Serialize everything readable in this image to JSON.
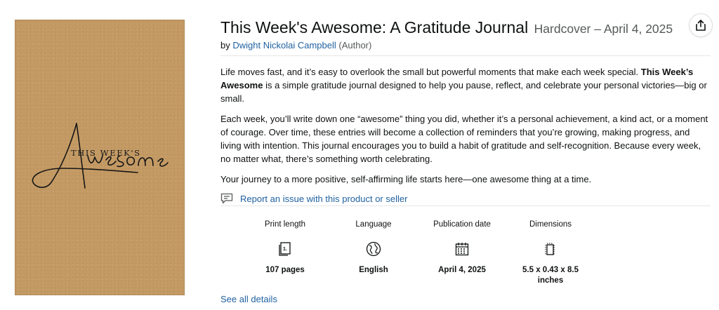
{
  "cover": {
    "top_text": "THIS WEEK'S",
    "script_text": "Awesome"
  },
  "product": {
    "title": "This Week's Awesome: A Gratitude Journal",
    "format_date": "Hardcover – April 4, 2025",
    "by_prefix": "by",
    "author": "Dwight Nickolai Campbell",
    "author_role": "(Author)"
  },
  "description": {
    "p1_a": "Life moves fast, and it’s easy to overlook the small but powerful moments that make each week special. ",
    "p1_bold": "This Week’s Awesome",
    "p1_b": " is a simple gratitude journal designed to help you pause, reflect, and celebrate your personal victories—big or small.",
    "p2": "Each week, you’ll write down one “awesome” thing you did, whether it’s a personal achievement, a kind act, or a moment of courage. Over time, these entries will become a collection of reminders that you’re growing, making progress, and living with intention. This journal encourages you to build a habit of gratitude and self-recognition. Because every week, no matter what, there’s something worth celebrating.",
    "p3": "Your journey to a more positive, self-affirming life starts here—one awesome thing at a time."
  },
  "report_link": "Report an issue with this product or seller",
  "specs": [
    {
      "label": "Print length",
      "icon": "pages-icon",
      "value": "107 pages"
    },
    {
      "label": "Language",
      "icon": "globe-icon",
      "value": "English"
    },
    {
      "label": "Publication date",
      "icon": "calendar-icon",
      "value": "April 4, 2025"
    },
    {
      "label": "Dimensions",
      "icon": "dimensions-icon",
      "value": "5.5 x 0.43 x 8.5 inches"
    }
  ],
  "see_all_details": "See all details",
  "colors": {
    "link": "#2162a1",
    "muted": "#565959",
    "cover": "#c49a64"
  }
}
